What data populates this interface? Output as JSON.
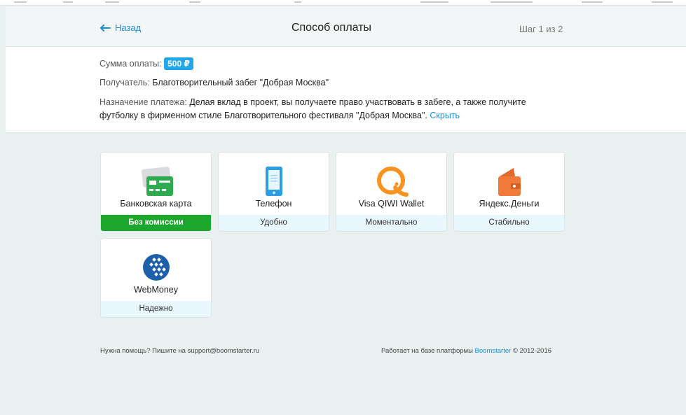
{
  "header": {
    "back_label": "Назад",
    "title": "Способ оплаты",
    "step": "Шаг 1 из 2"
  },
  "info": {
    "amount_label": "Сумма оплаты:",
    "amount_value": "500 ₽",
    "recipient_label": "Получатель:",
    "recipient_value": "Благотворительный забег \"Добрая Москва\"",
    "purpose_label": "Назначение платежа:",
    "purpose_line1": "Делая вклад в проект, вы получаете право участвовать в забеге, а также получите",
    "purpose_line2": "футболку в фирменном стиле Благотворительного фестиваля \"Добрая Москва\".",
    "hide_link": "Скрыть"
  },
  "methods": [
    {
      "name": "Банковская карта",
      "tag": "Без комиссии",
      "icon": "bank-card-icon"
    },
    {
      "name": "Телефон",
      "tag": "Удобно",
      "icon": "phone-icon"
    },
    {
      "name": "Visa QIWI Wallet",
      "tag": "Моментально",
      "icon": "qiwi-icon"
    },
    {
      "name": "Яндекс.Деньги",
      "tag": "Стабильно",
      "icon": "yandex-money-icon"
    },
    {
      "name": "WebMoney",
      "tag": "Надежно",
      "icon": "webmoney-icon"
    }
  ],
  "footer": {
    "help_text": "Нужна помощь? Пишите на support@boomstarter.ru",
    "platform_prefix": "Работает на базе платформы",
    "platform_link": "Boomstarter",
    "platform_suffix": "© 2012-2016"
  },
  "colors": {
    "accent": "#1a8fd6",
    "amount_badge": "#22a7e8",
    "green_tag": "#1aa72b",
    "background": "#e9f0f0"
  }
}
